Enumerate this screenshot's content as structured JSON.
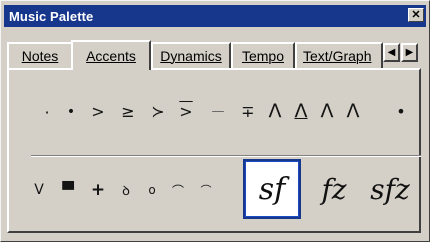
{
  "window": {
    "title": "Music Palette",
    "close_glyph": "✕"
  },
  "tabs": [
    {
      "label": "Notes"
    },
    {
      "label": "Accents",
      "active": true
    },
    {
      "label": "Dynamics"
    },
    {
      "label": "Tempo"
    },
    {
      "label": "Text/Graph"
    }
  ],
  "tab_scroll": {
    "left_glyph": "◀",
    "right_glyph": "▶"
  },
  "accents_row1": [
    {
      "icon": "staccato-small-icon",
      "glyph": "·"
    },
    {
      "icon": "staccato-icon",
      "glyph": "•"
    },
    {
      "icon": "accent-icon",
      "glyph": ">"
    },
    {
      "icon": "accent-tenuto-icon",
      "glyph": "≥"
    },
    {
      "icon": "accent-tenuto-above-icon",
      "glyph": "≻"
    },
    {
      "icon": "accent-staccato-icon",
      "glyph": ">"
    },
    {
      "icon": "tenuto-icon",
      "glyph": "—"
    },
    {
      "icon": "tenuto-staccato-icon",
      "glyph": "∓"
    },
    {
      "icon": "marcato-icon",
      "glyph": "Λ"
    },
    {
      "icon": "marcato-tenuto-icon",
      "glyph": "Λ"
    },
    {
      "icon": "marcato-staccato-icon",
      "glyph": "Λ"
    },
    {
      "icon": "marcato-staccato-dot-icon",
      "glyph": "Λ"
    },
    {
      "icon": "staccatissimo-icon",
      "glyph": "•"
    }
  ],
  "accents_row2": [
    {
      "icon": "up-bow-icon",
      "glyph": "V"
    },
    {
      "icon": "down-bow-icon",
      "glyph": "▀"
    },
    {
      "icon": "stopped-icon",
      "glyph": "+"
    },
    {
      "icon": "thumb-icon",
      "glyph": "ꝺ"
    },
    {
      "icon": "harmonic-icon",
      "glyph": "o"
    },
    {
      "icon": "fermata-icon",
      "glyph": "⌒"
    },
    {
      "icon": "fermata-short-icon",
      "glyph": "⌒"
    }
  ],
  "dynamics": [
    {
      "label": "sf",
      "selected": true
    },
    {
      "label": "fz",
      "selected": false
    },
    {
      "label": "sfz",
      "selected": false
    }
  ]
}
